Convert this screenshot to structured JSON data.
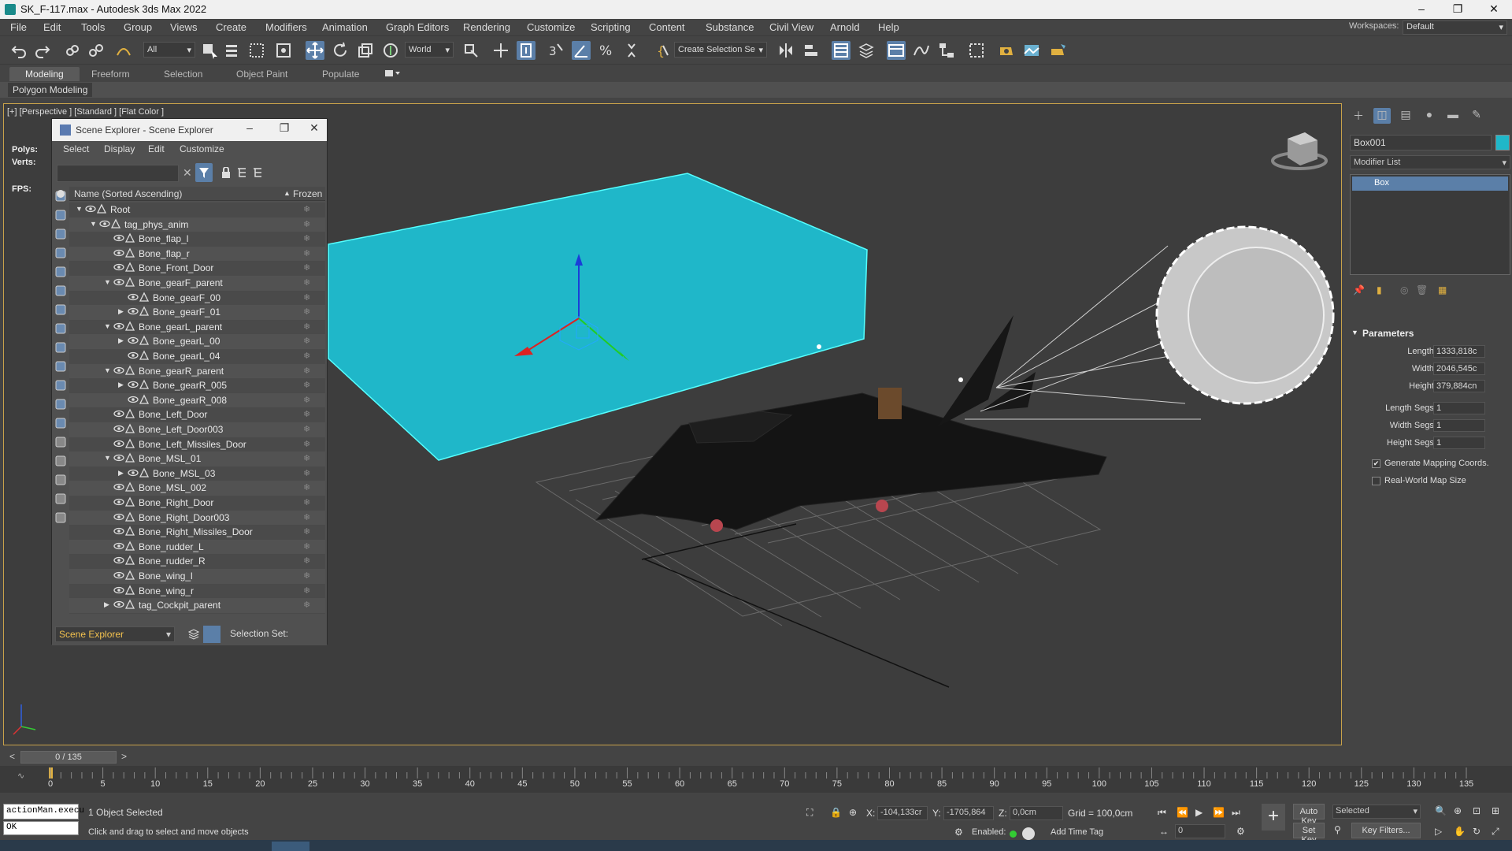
{
  "window": {
    "title": "SK_F-117.max - Autodesk 3ds Max 2022",
    "controls": [
      "–",
      "❐",
      "✕"
    ]
  },
  "menu": [
    "File",
    "Edit",
    "Tools",
    "Group",
    "Views",
    "Create",
    "Modifiers",
    "Animation",
    "Graph Editors",
    "Rendering",
    "Customize",
    "Scripting",
    "Content",
    "Substance",
    "Civil View",
    "Arnold",
    "Help"
  ],
  "workspaces": {
    "label": "Workspaces:",
    "value": "Default"
  },
  "toolbar": {
    "filter": "All",
    "coord": "World",
    "selection_set": "Create Selection Se"
  },
  "ribbon": {
    "tabs": [
      "Modeling",
      "Freeform",
      "Selection",
      "Object Paint",
      "Populate"
    ],
    "active": "Modeling",
    "sub_label": "Polygon Modeling"
  },
  "viewport": {
    "label": "[+] [Perspective ] [Standard ] [Flat Color ]",
    "stats": {
      "polys_label": "Polys:",
      "verts_label": "Verts:",
      "fps_label": "FPS:"
    }
  },
  "scene_explorer": {
    "title": "Scene Explorer - Scene Explorer",
    "menu": [
      "Select",
      "Display",
      "Edit",
      "Customize"
    ],
    "col_name": "Name (Sorted Ascending)",
    "col_frozen": "Frozen",
    "items": [
      {
        "name": "Root",
        "depth": 0,
        "caret": "▼"
      },
      {
        "name": "tag_phys_anim",
        "depth": 1,
        "caret": "▼"
      },
      {
        "name": "Bone_flap_l",
        "depth": 2,
        "caret": ""
      },
      {
        "name": "Bone_flap_r",
        "depth": 2,
        "caret": ""
      },
      {
        "name": "Bone_Front_Door",
        "depth": 2,
        "caret": ""
      },
      {
        "name": "Bone_gearF_parent",
        "depth": 2,
        "caret": "▼"
      },
      {
        "name": "Bone_gearF_00",
        "depth": 3,
        "caret": ""
      },
      {
        "name": "Bone_gearF_01",
        "depth": 3,
        "caret": "▶"
      },
      {
        "name": "Bone_gearL_parent",
        "depth": 2,
        "caret": "▼"
      },
      {
        "name": "Bone_gearL_00",
        "depth": 3,
        "caret": "▶"
      },
      {
        "name": "Bone_gearL_04",
        "depth": 3,
        "caret": ""
      },
      {
        "name": "Bone_gearR_parent",
        "depth": 2,
        "caret": "▼"
      },
      {
        "name": "Bone_gearR_005",
        "depth": 3,
        "caret": "▶"
      },
      {
        "name": "Bone_gearR_008",
        "depth": 3,
        "caret": ""
      },
      {
        "name": "Bone_Left_Door",
        "depth": 2,
        "caret": ""
      },
      {
        "name": "Bone_Left_Door003",
        "depth": 2,
        "caret": ""
      },
      {
        "name": "Bone_Left_Missiles_Door",
        "depth": 2,
        "caret": ""
      },
      {
        "name": "Bone_MSL_01",
        "depth": 2,
        "caret": "▼"
      },
      {
        "name": "Bone_MSL_03",
        "depth": 3,
        "caret": "▶"
      },
      {
        "name": "Bone_MSL_002",
        "depth": 2,
        "caret": ""
      },
      {
        "name": "Bone_Right_Door",
        "depth": 2,
        "caret": ""
      },
      {
        "name": "Bone_Right_Door003",
        "depth": 2,
        "caret": ""
      },
      {
        "name": "Bone_Right_Missiles_Door",
        "depth": 2,
        "caret": ""
      },
      {
        "name": "Bone_rudder_L",
        "depth": 2,
        "caret": ""
      },
      {
        "name": "Bone_rudder_R",
        "depth": 2,
        "caret": ""
      },
      {
        "name": "Bone_wing_l",
        "depth": 2,
        "caret": ""
      },
      {
        "name": "Bone_wing_r",
        "depth": 2,
        "caret": ""
      },
      {
        "name": "tag_Cockpit_parent",
        "depth": 2,
        "caret": "▶"
      }
    ],
    "footer_dropdown": "Scene Explorer",
    "selection_set_label": "Selection Set:"
  },
  "command_panel": {
    "object_name": "Box001",
    "object_color": "#1fb7c9",
    "modifier_list": "Modifier List",
    "stack_item": "Box",
    "rollout": "Parameters",
    "params": [
      {
        "label": "Length:",
        "value": "1333,818c"
      },
      {
        "label": "Width:",
        "value": "2046,545c"
      },
      {
        "label": "Height:",
        "value": "379,884cn"
      },
      {
        "label": "Length Segs:",
        "value": "1"
      },
      {
        "label": "Width Segs:",
        "value": "1"
      },
      {
        "label": "Height Segs:",
        "value": "1"
      }
    ],
    "checks": [
      {
        "label": "Generate Mapping Coords.",
        "checked": "✔"
      },
      {
        "label": "Real-World Map Size",
        "checked": ""
      }
    ]
  },
  "timeline": {
    "slider": "0 / 135",
    "ticks": [
      "0",
      "5",
      "10",
      "15",
      "20",
      "25",
      "30",
      "35",
      "40",
      "45",
      "50",
      "55",
      "60",
      "65",
      "70",
      "75",
      "80",
      "85",
      "90",
      "95",
      "100",
      "105",
      "110",
      "115",
      "120",
      "125",
      "130",
      "135"
    ]
  },
  "status": {
    "maxscript_line": "actionMan.execu",
    "maxscript_out": "OK",
    "selected": "1 Object Selected",
    "prompt": "Click and drag to select and move objects",
    "x_label": "X:",
    "x_value": "-104,133cr",
    "y_label": "Y:",
    "y_value": "-1705,864",
    "z_label": "Z:",
    "z_value": "0,0cm",
    "grid": "Grid = 100,0cm",
    "enabled_label": "Enabled:",
    "add_time_tag": "Add Time Tag",
    "auto_key": "Auto Key",
    "set_key": "Set Key",
    "key_mode": "Selected",
    "key_filters": "Key Filters...",
    "frame": "0"
  },
  "colors": {
    "accent": "#5b7fa8",
    "box_cyan": "#1fb7c9",
    "viewport_border": "#c8a24a"
  }
}
